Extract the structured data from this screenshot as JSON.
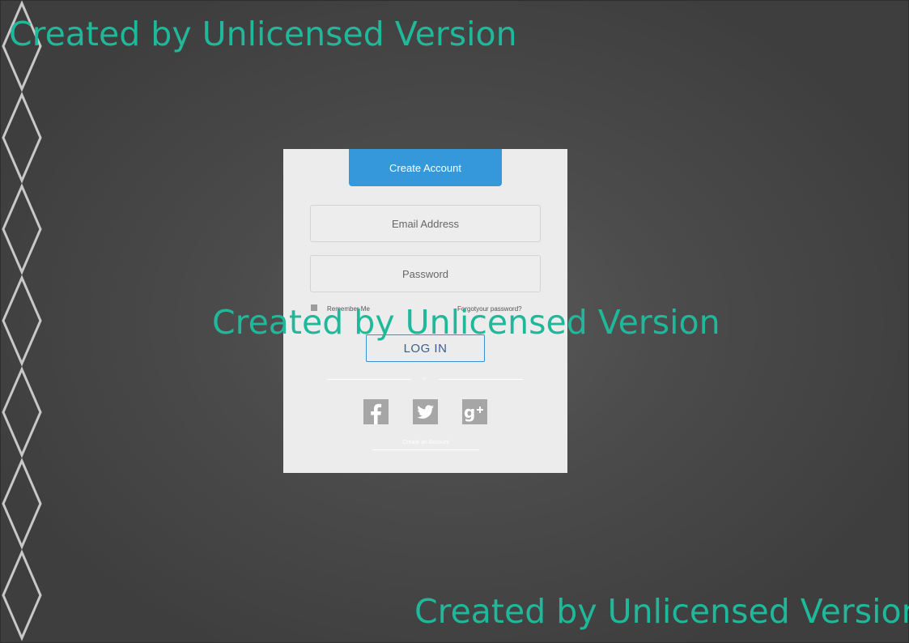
{
  "watermark": {
    "text": "Created by Unlicensed Version"
  },
  "login_form": {
    "create_account_button": "Create Account",
    "email_placeholder": "Email Address",
    "password_placeholder": "Password",
    "remember_me_label": "Remember Me",
    "forgot_password_link": "Forgotyour password?",
    "login_button": "LOG IN",
    "divider_text": "or",
    "social_icons": [
      "facebook-icon",
      "twitter-icon",
      "google-plus-icon"
    ],
    "create_account_link": "Create an Account"
  },
  "colors": {
    "primary_button": "#3498db",
    "login_border": "#3b8ed0",
    "card_background": "#ececec",
    "watermark": "#1fb89a",
    "social_tile": "#a6a6a6"
  }
}
